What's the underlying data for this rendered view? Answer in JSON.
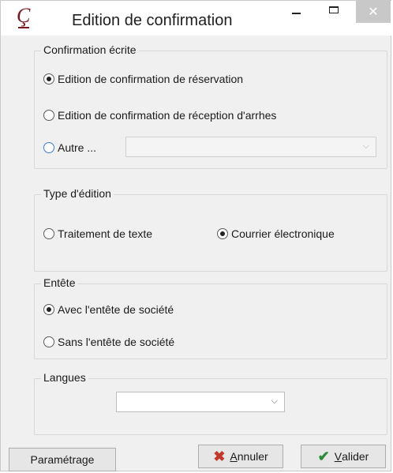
{
  "window": {
    "title": "Edition de confirmation",
    "app_icon_glyph": "Ç",
    "close_glyph": "✕"
  },
  "groups": {
    "confirmation": {
      "legend": "Confirmation écrite",
      "options": [
        {
          "label": "Edition de confirmation de réservation",
          "checked": true
        },
        {
          "label": "Edition de confirmation de réception d'arrhes",
          "checked": false
        },
        {
          "label": "Autre ...",
          "checked": false
        }
      ],
      "other_select_value": ""
    },
    "edition_type": {
      "legend": "Type d'édition",
      "options": [
        {
          "label": "Traitement de texte",
          "checked": false
        },
        {
          "label": "Courrier électronique",
          "checked": true
        }
      ]
    },
    "header": {
      "legend": "Entête",
      "options": [
        {
          "label": "Avec l'entête de société",
          "checked": true
        },
        {
          "label": "Sans l'entête de société",
          "checked": false
        }
      ]
    },
    "languages": {
      "legend": "Langues",
      "select_value": ""
    }
  },
  "buttons": {
    "settings": "Paramétrage",
    "cancel_prefix": "",
    "cancel_mnemonic": "A",
    "cancel_rest": "nnuler",
    "validate_mnemonic": "V",
    "validate_rest": "alider"
  },
  "icons": {
    "app": "app-logo-icon",
    "minimize": "minimize-icon",
    "maximize": "maximize-icon",
    "close": "close-icon",
    "cancel": "cross-icon",
    "validate": "checkmark-icon",
    "dropdown": "chevron-down-icon"
  },
  "colors": {
    "window_bg": "#f0f0f0",
    "cancel_icon": "#c0392b",
    "validate_icon": "#2e8b3a",
    "close_button": "#c8c8c8"
  }
}
